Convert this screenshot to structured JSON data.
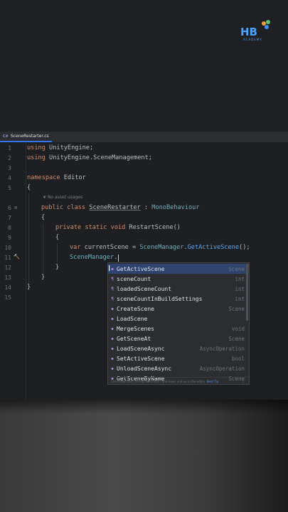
{
  "logo": {
    "text": "HB",
    "subtitle": "ACADEMY"
  },
  "tab": {
    "label": "SceneRestarter.cs",
    "icon": "csharp-file-icon"
  },
  "gutter": {
    "line_numbers": [
      "1",
      "2",
      "3",
      "4",
      "5",
      "6",
      "7",
      "8",
      "9",
      "10",
      "11",
      "12",
      "13",
      "14",
      "15"
    ]
  },
  "code": {
    "l1": [
      "using",
      " UnityEngine;"
    ],
    "l2": [
      "using",
      " UnityEngine.SceneManagement;"
    ],
    "l4": [
      "namespace",
      " Editor"
    ],
    "l5": "{",
    "usage_hint": "No asset usages",
    "l6": [
      "public",
      " ",
      "class",
      " ",
      "SceneRestarter",
      " : ",
      "MonoBehaviour"
    ],
    "l7": "{",
    "l8": [
      "private",
      " ",
      "static",
      " ",
      "void",
      " ",
      "RestartScene",
      "()"
    ],
    "l9": "{",
    "l10": [
      "var",
      " currentScene = ",
      "SceneManager",
      ".",
      "GetActiveScene",
      "();"
    ],
    "l11": [
      "SceneManager",
      "."
    ],
    "l12": "}",
    "l13": "}",
    "l14": "}"
  },
  "completion": {
    "items": [
      {
        "name": "GetActiveScene",
        "type": "Scene"
      },
      {
        "name": "sceneCount",
        "type": "int"
      },
      {
        "name": "loadedSceneCount",
        "type": "int"
      },
      {
        "name": "sceneCountInBuildSettings",
        "type": "int"
      },
      {
        "name": "CreateScene",
        "type": "Scene"
      },
      {
        "name": "LoadScene",
        "type": ""
      },
      {
        "name": "MergeScenes",
        "type": "void"
      },
      {
        "name": "GetSceneAt",
        "type": "Scene"
      },
      {
        "name": "LoadSceneAsync",
        "type": "AsyncOperation"
      },
      {
        "name": "SetActiveScene",
        "type": "bool"
      },
      {
        "name": "UnloadSceneAsync",
        "type": "AsyncOperation"
      },
      {
        "name": "GetSceneByName",
        "type": "Scene"
      }
    ],
    "footer_text": "Ctrl+Down and Ctrl+Up will move caret down and up in the editor",
    "footer_link": "Next Tip"
  },
  "colors": {
    "accent": "#3574f0",
    "selection": "#2e436e",
    "keyword": "#cf8e6d",
    "method": "#57aaf7",
    "type": "#6fafbd"
  }
}
